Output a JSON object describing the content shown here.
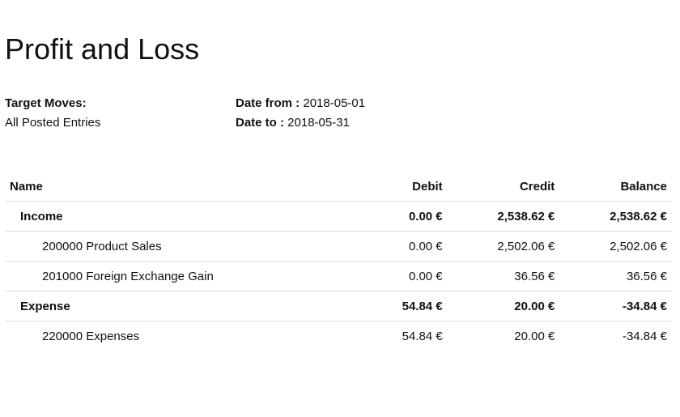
{
  "report": {
    "title": "Profit and Loss",
    "target_moves_label": "Target Moves:",
    "target_moves_value": "All Posted Entries",
    "date_from_label": "Date from :",
    "date_from_value": "2018-05-01",
    "date_to_label": "Date to :",
    "date_to_value": "2018-05-31"
  },
  "table": {
    "headers": {
      "name": "Name",
      "debit": "Debit",
      "credit": "Credit",
      "balance": "Balance"
    },
    "rows": [
      {
        "type": "group",
        "name": "Income",
        "debit": "0.00 €",
        "credit": "2,538.62 €",
        "balance": "2,538.62 €"
      },
      {
        "type": "account",
        "name": "200000 Product Sales",
        "debit": "0.00 €",
        "credit": "2,502.06 €",
        "balance": "2,502.06 €"
      },
      {
        "type": "account",
        "name": "201000 Foreign Exchange Gain",
        "debit": "0.00 €",
        "credit": "36.56 €",
        "balance": "36.56 €"
      },
      {
        "type": "group",
        "name": "Expense",
        "debit": "54.84 €",
        "credit": "20.00 €",
        "balance": "-34.84 €"
      },
      {
        "type": "account",
        "name": "220000 Expenses",
        "debit": "54.84 €",
        "credit": "20.00 €",
        "balance": "-34.84 €"
      }
    ]
  }
}
